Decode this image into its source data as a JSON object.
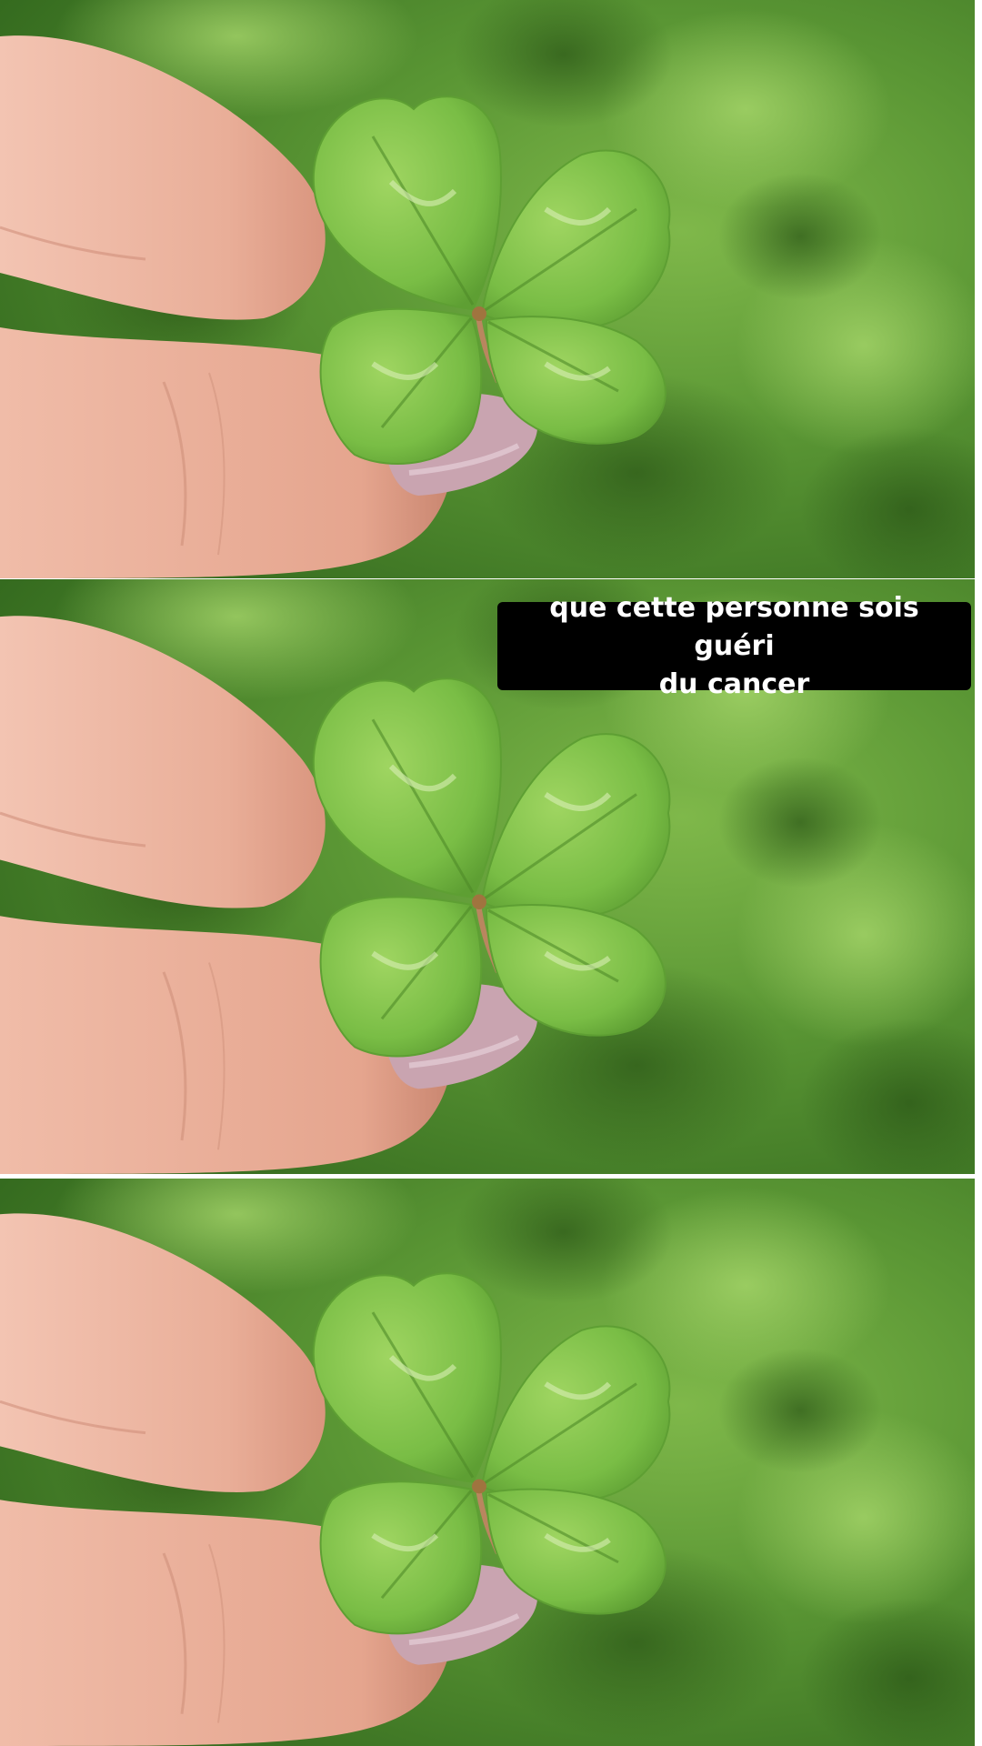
{
  "caption": {
    "text": "que cette personne sois guéri\ndu cancer",
    "background": "#000000",
    "color": "#ffffff"
  },
  "panels": [
    {
      "id": 1,
      "subject": "hand-holding-four-leaf-clover"
    },
    {
      "id": 2,
      "subject": "hand-holding-four-leaf-clover"
    },
    {
      "id": 3,
      "subject": "hand-holding-four-leaf-clover"
    }
  ],
  "colors": {
    "background_green": "#4f8a2e",
    "clover_green": "#7cc04a",
    "skin": "#ecb8a4",
    "nail": "#c9a4b0"
  }
}
